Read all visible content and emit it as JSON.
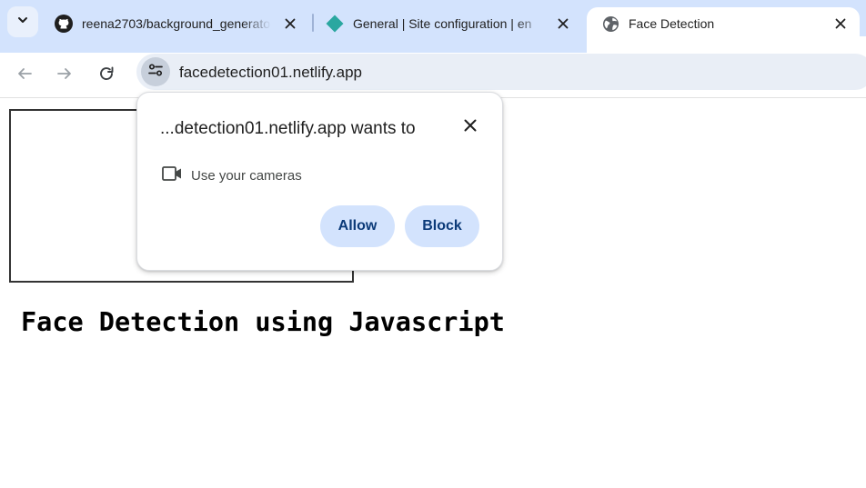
{
  "tabs": [
    {
      "title": "reena2703/background_generator",
      "favicon": "github-icon",
      "active": false
    },
    {
      "title": "General | Site configuration | en",
      "favicon": "netlify-icon",
      "active": false
    },
    {
      "title": "Face Detection",
      "favicon": "globe-icon",
      "active": true
    }
  ],
  "toolbar": {
    "url": "facedetection01.netlify.app"
  },
  "permission_prompt": {
    "title": "...detection01.netlify.app wants to",
    "permission_label": "Use your cameras",
    "allow_label": "Allow",
    "block_label": "Block"
  },
  "page": {
    "heading": "Face Detection using Javascript"
  },
  "colors": {
    "tabstrip": "#d3e3fd",
    "omnibox": "#e9eef6",
    "button_bg": "#d3e3fd",
    "button_text": "#0b3a78",
    "netlify": "#2aa7a0"
  }
}
